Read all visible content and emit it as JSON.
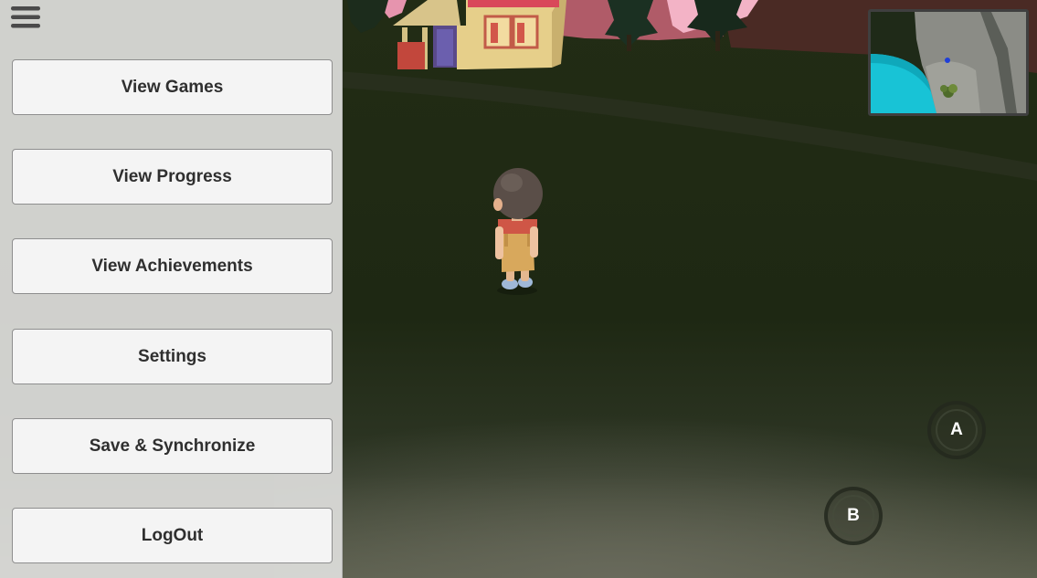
{
  "menu": {
    "toggle_icon": "hamburger-menu-icon",
    "items": [
      {
        "id": "view-games",
        "label": "View Games"
      },
      {
        "id": "view-progress",
        "label": "View Progress"
      },
      {
        "id": "view-achievements",
        "label": "View Achievements"
      },
      {
        "id": "settings",
        "label": "Settings"
      },
      {
        "id": "save-synchronize",
        "label": "Save & Synchronize"
      },
      {
        "id": "logout",
        "label": "LogOut"
      }
    ]
  },
  "controls": {
    "a_label": "A",
    "b_label": "B"
  },
  "colors": {
    "menu_panel": "#dededc",
    "button_face": "#f4f4f4",
    "button_text": "#2f2f2f",
    "grass": "#1f2a14",
    "minimap_water": "#16c6d8",
    "house_wall": "#e6cf8a",
    "house_roof": "#d9485a"
  }
}
